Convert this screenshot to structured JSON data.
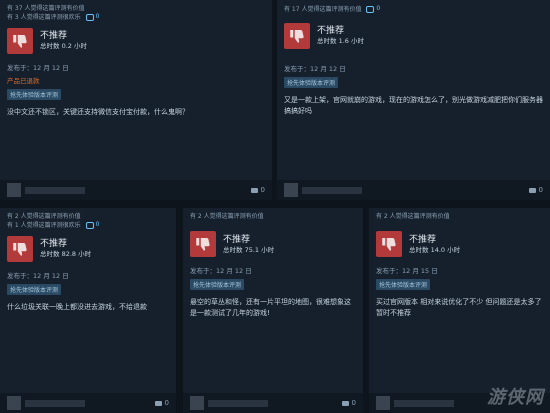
{
  "reviews": [
    {
      "helpful": "有 37 人觉得这篇评测有价值",
      "funny": "有 3 人觉得这篇评测很欢乐",
      "comment_icon_count": "0",
      "recommendation": "不推荐",
      "hours": "总时数 0.2 小时",
      "posted": "发布于：12 月 12 日",
      "product_tag": "产品已退款",
      "review_type": "抢先体验版本评测",
      "text": "没中文还不锁区，关键还支持微信支付宝付款，什么鬼啊？",
      "comments": "0"
    },
    {
      "helpful": "有 17 人觉得这篇评测有价值",
      "comment_icon_count": "0",
      "recommendation": "不推荐",
      "hours": "总时数 1.6 小时",
      "posted": "发布于：12 月 12 日",
      "review_type": "抢先体验版本评测",
      "text": "又是一款上架，官网就崩的游戏，现在的游戏怎么了，别光做游戏减肥把你们服务器搞搞好吗",
      "comments": "0"
    },
    {
      "helpful": "有 2 人觉得这篇评测有价值",
      "funny": "有 1 人觉得这篇评测很欢乐",
      "comment_icon_count": "0",
      "recommendation": "不推荐",
      "hours": "总时数 82.8 小时",
      "posted": "发布于：12 月 12 日",
      "review_type": "抢先体验版本评测",
      "text": "什么垃圾关联一晚上都没进去游戏，不给退款",
      "comments": "0"
    },
    {
      "helpful": "有 2 人觉得这篇评测有价值",
      "recommendation": "不推荐",
      "hours": "总时数 75.1 小时",
      "posted": "发布于：12 月 12 日",
      "review_type": "抢先体验版本评测",
      "text": "悬空的草丛和怪，还有一片平坦的地图，很难想象这是一款测试了几年的游戏!",
      "comments": "0"
    },
    {
      "helpful": "有 2 人觉得这篇评测有价值",
      "recommendation": "不推荐",
      "hours": "总时数 14.0 小时",
      "posted": "发布于：12 月 15 日",
      "review_type": "抢先体验版本评测",
      "text": "买过官网版本 相对来说优化了不少 但问题还是太多了 暂时不推荐",
      "comments": "0"
    }
  ],
  "watermark": "游侠网",
  "colors": {
    "thumb_bg": "#b23a3a",
    "card_bg": "#16202d",
    "link": "#67c1f5"
  }
}
